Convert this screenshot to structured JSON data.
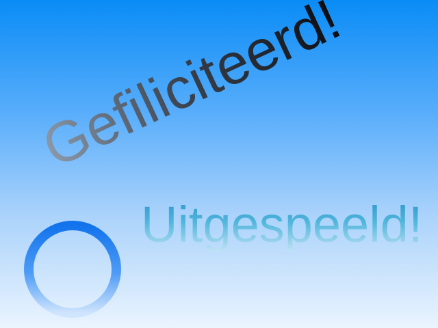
{
  "messages": {
    "congratulations": "Gefiliciteerd!",
    "finished": "Uitgespeeld!"
  },
  "icons": {
    "ring": "ring-icon"
  },
  "colors": {
    "background_top": "#0a8cf6",
    "background_bottom": "#eaf4fe",
    "congrats_text_dark": "#0b0d12",
    "finished_text": "#3aa6d4",
    "ring": "#1a7ef2"
  }
}
